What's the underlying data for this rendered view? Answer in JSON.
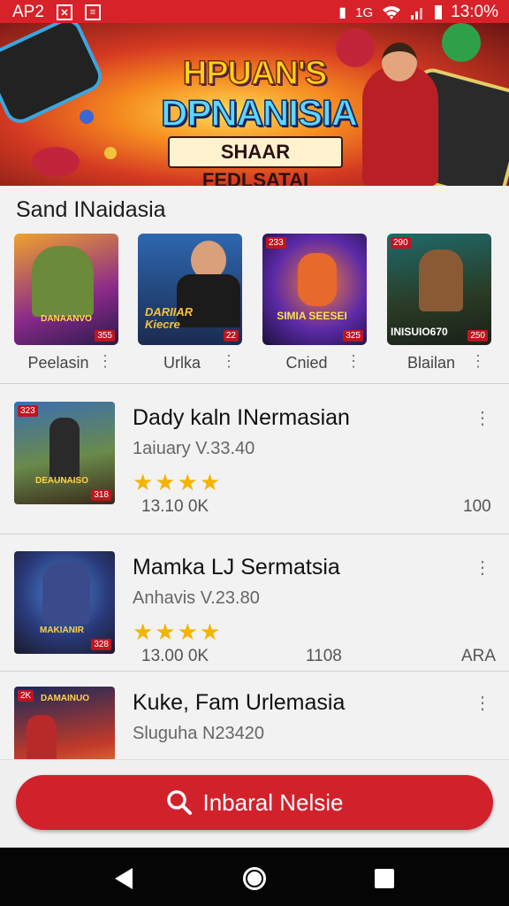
{
  "status_bar": {
    "left_text": "AP2",
    "right_text": "13:0%",
    "network": "1G",
    "icons": [
      "mail-icon",
      "notification-icon",
      "vibrate-icon",
      "wifi-icon",
      "signal-icon",
      "battery-icon"
    ]
  },
  "banner": {
    "title_line1": "HPUAN'S",
    "title_line2": "DPNANISIA",
    "subtitle": "SHAAR FEDLSATAI"
  },
  "section": {
    "title": "Sand INaidasia"
  },
  "featured": [
    {
      "label": "Peelasin",
      "badge": "355",
      "thumb_text": "DANAANVO",
      "accent": "#e8462b"
    },
    {
      "label": "Urlka",
      "badge": "22",
      "thumb_text": "DARIIAR Kiecre",
      "accent": "#2a6fb8"
    },
    {
      "label": "Cnied",
      "badge": "325",
      "badge_top": "233",
      "thumb_text": "SIMIA SEESEI",
      "accent": "#5c2aa8"
    },
    {
      "label": "Blailan",
      "badge": "250",
      "badge_top": "290",
      "thumb_text": "INISUIO670",
      "accent": "#1f7a5a"
    }
  ],
  "list_items": [
    {
      "title": "Dady kaln INermasian",
      "version": "1aiuary V.33.40",
      "stars": "★★★★",
      "downloads": "13.10 0K",
      "size": "100",
      "badge_top": "323",
      "badge_bottom": "318",
      "thumb_text": "DEAUNAISO"
    },
    {
      "title": "Mamka LJ Sermatsia",
      "version": "Anhavis V.23.80",
      "stars": "★★★★",
      "downloads": "13.00 0K",
      "size": "1108",
      "extra": "ARA",
      "badge_bottom": "328",
      "thumb_text": "MAKIANIR"
    },
    {
      "title": "Kuke, Fam Urlemasia",
      "version": "Sluguha N23420",
      "stars": "★★★★",
      "badge_top": "2K",
      "thumb_text": "DAMAINUO"
    }
  ],
  "install_button": {
    "label": "Inbaral Nelsie"
  },
  "colors": {
    "brand": "#d1222c",
    "star": "#f5b400"
  }
}
